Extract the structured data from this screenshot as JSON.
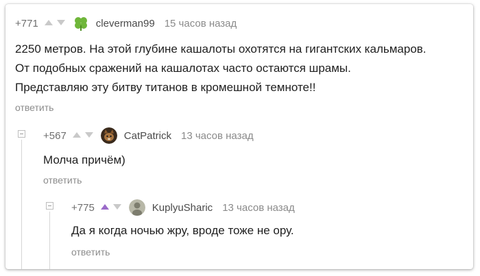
{
  "comments": [
    {
      "rating": "+771",
      "username": "cleverman99",
      "time": "15 часов назад",
      "lines": [
        "2250 метров. На этой глубине кашалоты охотятся на гигантских кальмаров.",
        "От подобных сражений на кашалотах часто остаются шрамы.",
        "Представляю эту битву титанов в кромешной темноте!!"
      ],
      "reply_label": "ответить",
      "avatar_icon": "clover-icon"
    },
    {
      "rating": "+567",
      "username": "CatPatrick",
      "time": "13 часов назад",
      "lines": [
        "Молча причём)"
      ],
      "reply_label": "ответить",
      "avatar_icon": "cat-avatar"
    },
    {
      "rating": "+775",
      "username": "KuplyuSharic",
      "time": "13 часов назад",
      "lines": [
        "Да я когда ночью жру, вроде тоже не ору."
      ],
      "reply_label": "ответить",
      "avatar_icon": "user-avatar",
      "upvoted": true
    }
  ],
  "colors": {
    "vote_inactive": "#c9c9c9",
    "vote_active": "#9b6bc9",
    "clover": "#6fb63a",
    "thread_line": "#d6d6d6"
  }
}
